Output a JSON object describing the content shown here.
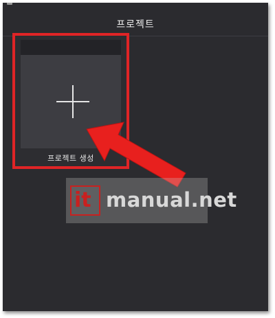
{
  "header": {
    "title": "프로젝트"
  },
  "project_card": {
    "label": "프로젝트 생성",
    "icon": "plus-icon"
  },
  "annotation": {
    "color": "#e02426",
    "arrow_icon": "red-arrow"
  },
  "watermark": {
    "logo_text": "it",
    "text": "manual.net",
    "logo_color": "#c9201f"
  }
}
